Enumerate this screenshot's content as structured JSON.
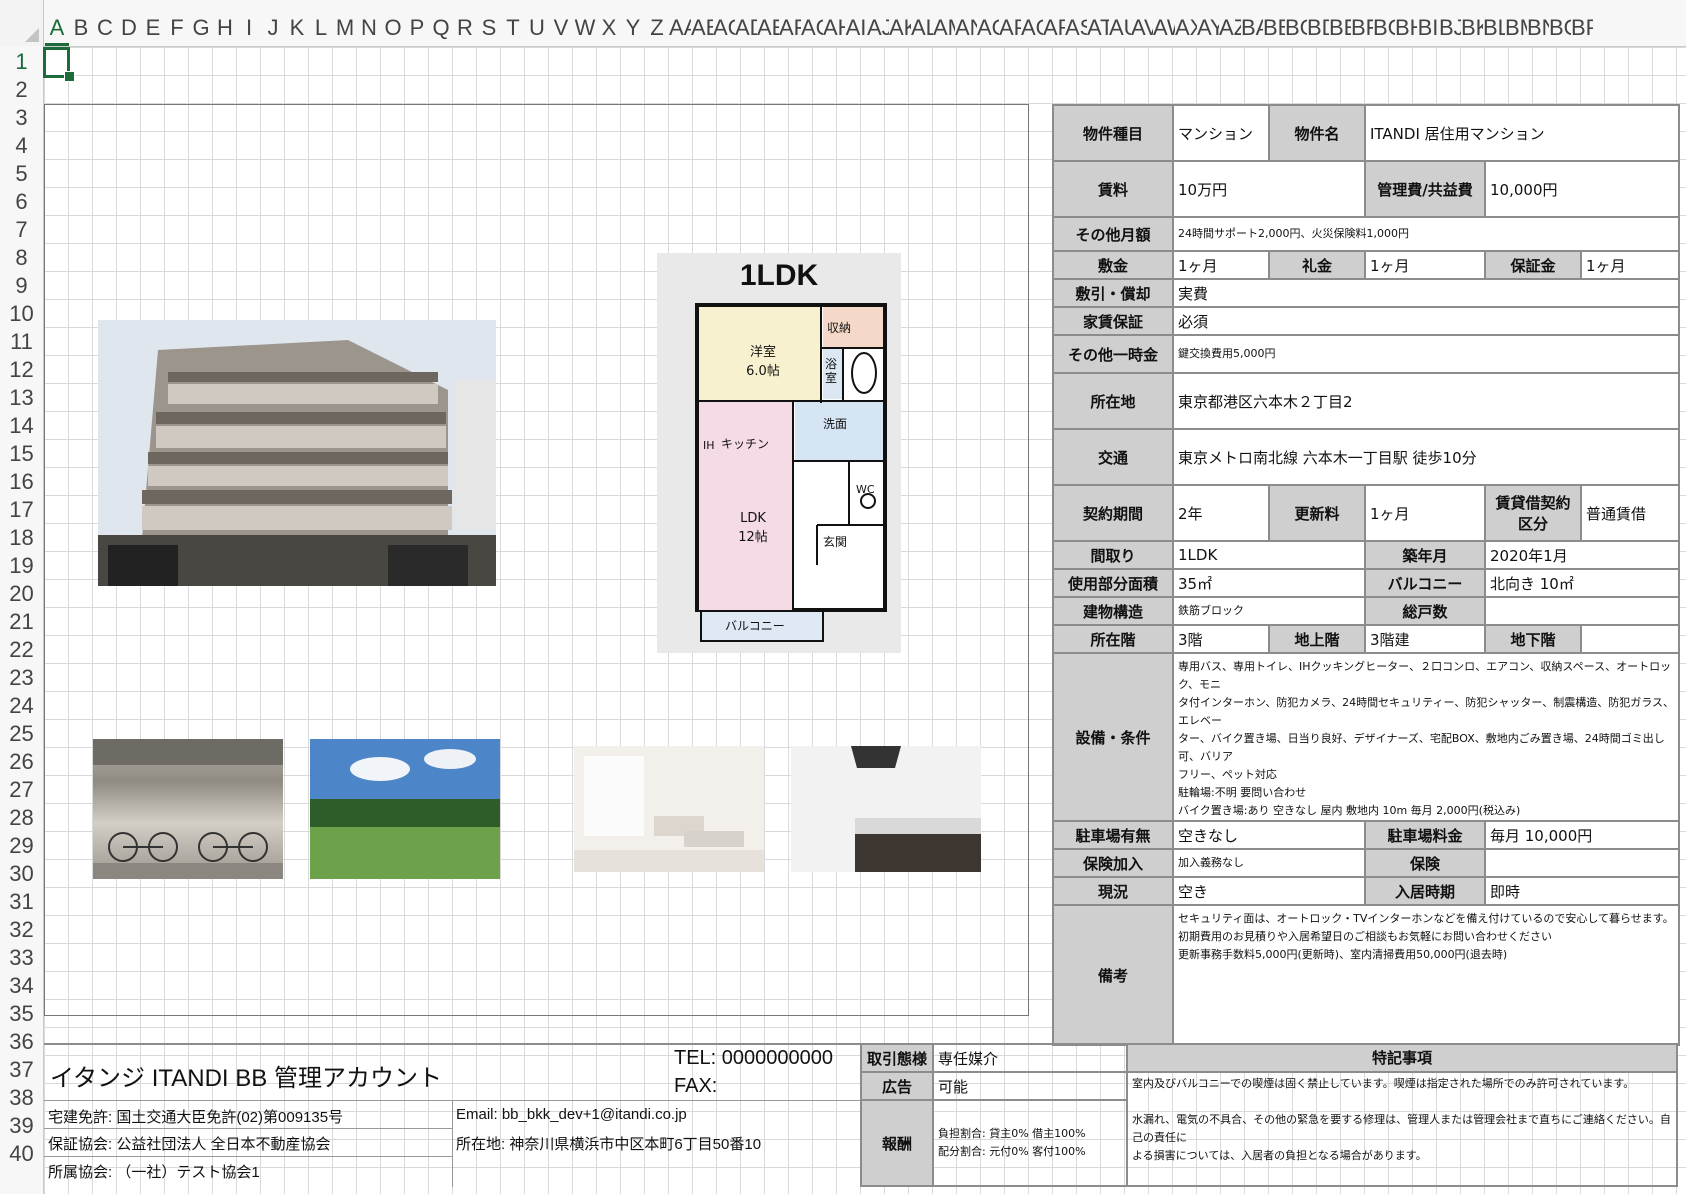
{
  "spreadsheet": {
    "columns": [
      "A",
      "B",
      "C",
      "D",
      "E",
      "F",
      "G",
      "H",
      "I",
      "J",
      "K",
      "L",
      "M",
      "N",
      "O",
      "P",
      "Q",
      "R",
      "S",
      "T",
      "U",
      "V",
      "W",
      "X",
      "Y",
      "Z",
      "AA",
      "AB",
      "AC",
      "AD",
      "AE",
      "AF",
      "AG",
      "AH",
      "AI",
      "AJ",
      "AK",
      "AL",
      "AM",
      "AN",
      "AO",
      "AP",
      "AQ",
      "AR",
      "AS",
      "AT",
      "AU",
      "AV",
      "AW",
      "AX",
      "AY",
      "AZ",
      "BA",
      "BB",
      "BC",
      "BD",
      "BE",
      "BF",
      "BG",
      "BH",
      "BI",
      "BJ",
      "BK",
      "BL",
      "BM",
      "BN",
      "BO",
      "BP"
    ],
    "rows": [
      "1",
      "2",
      "3",
      "4",
      "5",
      "6",
      "7",
      "8",
      "9",
      "10",
      "11",
      "12",
      "13",
      "14",
      "15",
      "16",
      "17",
      "18",
      "19",
      "20",
      "21",
      "22",
      "23",
      "24",
      "25",
      "26",
      "27",
      "28",
      "29",
      "30",
      "31",
      "32",
      "33",
      "34",
      "35",
      "36",
      "37",
      "38",
      "39",
      "40"
    ],
    "active_column": "A",
    "active_row": "1",
    "accent_color": "#1d6b3a"
  },
  "floorplan": {
    "title": "1LDK",
    "room_western": "洋室",
    "room_western_size": "6.0帖",
    "storage": "収納",
    "bath": "浴室",
    "washroom": "洗面",
    "kitchen": "キッチン",
    "ih": "IH",
    "wc": "WC",
    "ldk": "LDK",
    "ldk_size": "12帖",
    "entrance": "玄関",
    "balcony": "バルコニー"
  },
  "property": {
    "type_label": "物件種目",
    "type": "マンション",
    "name_label": "物件名",
    "name": "ITANDI 居住用マンション",
    "rent_label": "賃料",
    "rent": "10万円",
    "mgmt_label": "管理費/共益費",
    "mgmt": "10,000円",
    "other_monthly_label": "その他月額",
    "other_monthly": "24時間サポート2,000円、火災保険料1,000円",
    "deposit_label": "敷金",
    "deposit": "1ヶ月",
    "key_money_label": "礼金",
    "key_money": "1ヶ月",
    "guarantee_money_label": "保証金",
    "guarantee_money": "1ヶ月",
    "deduction_label": "敷引・償却",
    "deduction": "実費",
    "rent_guarantee_label": "家賃保証",
    "rent_guarantee": "必須",
    "other_onetime_label": "その他一時金",
    "other_onetime": "鍵交換費用5,000円",
    "address_label": "所在地",
    "address": "東京都港区六本木２丁目2",
    "transit_label": "交通",
    "transit": "東京メトロ南北線 六本木一丁目駅 徒歩10分",
    "contract_label": "契約期間",
    "contract": "2年",
    "renewal_label": "更新料",
    "renewal": "1ヶ月",
    "lease_type_label": "賃貸借契約区分",
    "lease_type": "普通賃借",
    "layout_label": "間取り",
    "layout": "1LDK",
    "built_label": "築年月",
    "built": "2020年1月",
    "area_label": "使用部分面積",
    "area": "35㎡",
    "balcony_label": "バルコニー",
    "balcony": "北向き 10㎡",
    "structure_label": "建物構造",
    "structure": "鉄筋ブロック",
    "units_label": "総戸数",
    "units": "",
    "floor_label": "所在階",
    "floor": "3階",
    "above_label": "地上階",
    "above": "3階建",
    "below_label": "地下階",
    "below": "",
    "equipment_label": "設備・条件",
    "equipment": [
      "専用バス、専用トイレ、IHクッキングヒーター、２口コンロ、エアコン、収納スペース、オートロック、モニ",
      "タ付インターホン、防犯カメラ、24時間セキュリティー、防犯シャッター、制震構造、防犯ガラス、エレベー",
      "ター、バイク置き場、日当り良好、デザイナーズ、宅配BOX、敷地内ごみ置き場、24時間ゴミ出し可、バリア",
      "フリー、ペット対応",
      "駐輪場:不明 要問い合わせ",
      "バイク置き場:あり 空きなし 屋内 敷地内 10m 毎月 2,000円(税込み)"
    ],
    "parking_label": "駐車場有無",
    "parking": "空きなし",
    "parking_fee_label": "駐車場料金",
    "parking_fee": "毎月 10,000円",
    "insurance_join_label": "保険加入",
    "insurance_join": "加入義務なし",
    "insurance_label": "保険",
    "insurance": "",
    "status_label": "現況",
    "status": "空き",
    "move_in_label": "入居時期",
    "move_in": "即時",
    "remarks_label": "備考",
    "remarks": [
      "セキュリティ面は、オートロック・TVインターホンなどを備え付けているので安心して暮らせます。",
      "初期費用のお見積りや入居希望日のご相談もお気軽にお問い合わせください",
      "更新事務手数料5,000円(更新時)、室内清掃費用50,000円(退去時)"
    ]
  },
  "agent": {
    "name": "イタンジ ITANDI BB 管理アカウント",
    "tel": "TEL: 0000000000",
    "fax": "FAX:",
    "license": "宅建免許: 国土交通大臣免許(02)第009135号",
    "email": "Email: bb_bkk_dev+1@itandi.co.jp",
    "association": "保証協会: 公益社団法人 全日本不動産協会",
    "address": "所在地: 神奈川県横浜市中区本町6丁目50番10",
    "member": "所属協会: （一社）テスト協会1"
  },
  "deal": {
    "mode_label": "取引態様",
    "mode": "専任媒介",
    "ad_label": "広告",
    "ad": "可能",
    "fee_label": "報酬",
    "fee_lines": [
      "負担割合: 貸主0% 借主100%",
      "配分割合: 元付0% 客付100%"
    ]
  },
  "notes": {
    "title": "特記事項",
    "lines": [
      "室内及びバルコニーでの喫煙は固く禁止しています。喫煙は指定された場所でのみ許可されています。",
      "",
      "水漏れ、電気の不具合、その他の緊急を要する修理は、管理人または管理会社まで直ちにご連絡ください。自己の責任に",
      "よる損害については、入居者の負担となる場合があります。"
    ]
  }
}
